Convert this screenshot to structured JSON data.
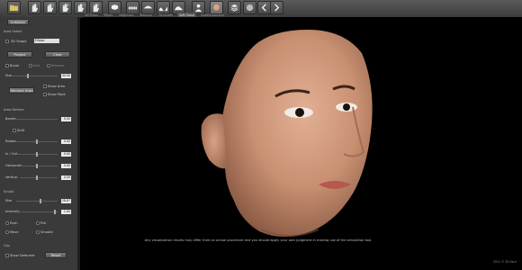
{
  "toolbar": {
    "tabs": [
      "3D Photo",
      "Bright",
      "Alignment",
      "Measure",
      "Thickness",
      "Soft-Tissue",
      "Superimposition"
    ],
    "active_tab": "Soft-Tissue",
    "icons": [
      "folder-icon",
      "hand-icon",
      "hand-rotate-icon",
      "hand-zoom-icon",
      "hand-pan-icon",
      "hand-move-icon",
      "dental-icon",
      "teeth-icon",
      "jaw-icon",
      "wave-icon",
      "face-profile-icon",
      "user-icon",
      "layers-icon",
      "back-arrow-icon",
      "forward-arrow-icon"
    ]
  },
  "panel": {
    "initialize": "Initialize",
    "area_select": "Area Select",
    "shape_label": "3D Shape",
    "shape_value": "Ellipse",
    "project": "Project",
    "clear": "Clear",
    "modes": [
      "Brush",
      "Add",
      "Remove"
    ],
    "size_label": "Size",
    "size_value": "40.00",
    "show_area": "Show Area",
    "remove_area": "Remove Area",
    "show_point": "Show Point",
    "area_deform": "Area Deform",
    "border": "Border",
    "border_value": "0.00",
    "shift": "Shift",
    "rotate": "Rotate",
    "rotate_value": "0.00",
    "in_out": "In / Out",
    "in_out_value": "0.00",
    "horizontal": "Horizontal",
    "horizontal_value": "0.00",
    "vertical": "Vertical",
    "vertical_value": "0.00",
    "sculpt": "Sculpt",
    "sculpt_size": "Size",
    "sculpt_size_value": "28.87",
    "intensity": "Intensity",
    "intensity_value": "1.00",
    "push": "Push",
    "pull": "Pull",
    "move": "Move",
    "smooth": "Smooth",
    "clip": "Clip",
    "show_deformer": "Show Deformer",
    "reset": "Reset"
  },
  "viewport": {
    "disclaimer": "Any visualization results may differ from an actual procedure and you should apply your own judgment in making use of the simulation tool.",
    "copyright": "2011 © 3D-Face"
  },
  "colors": {
    "toolbar_bg": "#4a4a4a",
    "panel_bg": "#3a3a3a",
    "viewport_bg": "#000000",
    "skin": "#c99072"
  }
}
